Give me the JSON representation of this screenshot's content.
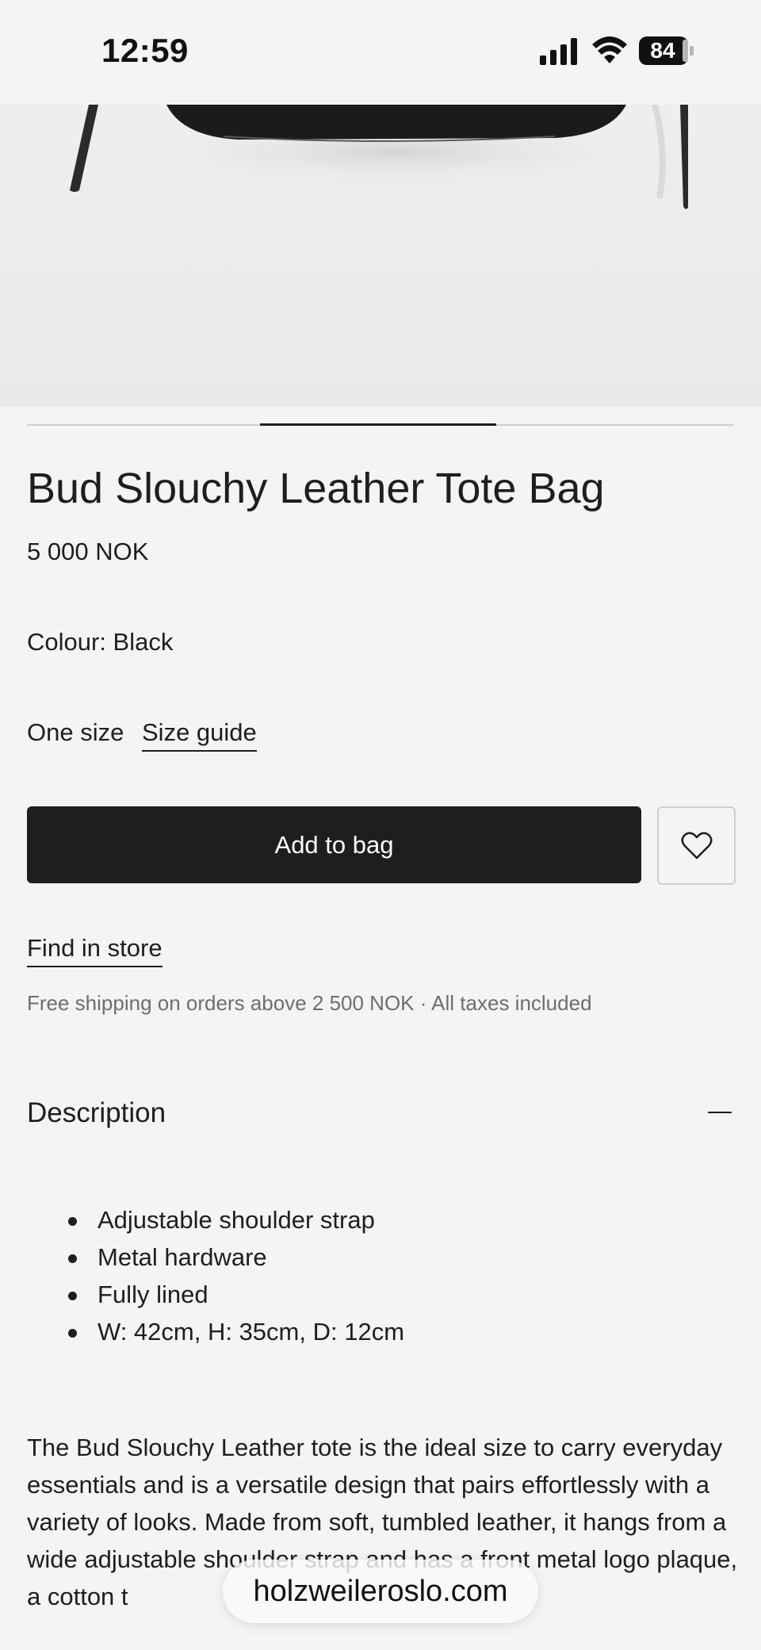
{
  "status_bar": {
    "time": "12:59",
    "battery": "84",
    "icons": [
      "signal-icon",
      "wifi-icon",
      "battery-icon"
    ]
  },
  "product": {
    "title": "Bud Slouchy Leather Tote Bag",
    "price": "5 000 NOK",
    "colour_label": "Colour: Black",
    "size_value": "One size",
    "size_guide_link": "Size guide"
  },
  "actions": {
    "add_to_bag": "Add to bag",
    "wishlist_icon": "heart-icon",
    "find_in_store": "Find in store"
  },
  "shipping_note": "Free shipping on orders above 2 500 NOK · All taxes included",
  "description": {
    "heading": "Description",
    "toggle_icon": "minus-icon",
    "bullets": [
      "Adjustable shoulder strap",
      "Metal hardware",
      "Fully lined",
      "W: 42cm, H: 35cm, D: 12cm"
    ],
    "paragraph": "The Bud Slouchy Leather tote is the ideal size to carry everyday essentials and is a versatile design that pairs effortlessly with a variety of looks. Made from soft, tumbled leather, it hangs from a wide adjustable shoulder strap and has a front metal logo plaque, a cotton t"
  },
  "browser": {
    "url": "holzweileroslo.com"
  },
  "colors": {
    "background": "#f4f4f4",
    "text": "#1f1e1c",
    "button": "#1f1e1c",
    "muted_text": "#6e6e6e"
  },
  "carousel": {
    "active_slide_index": 1,
    "slide_count": 3
  }
}
